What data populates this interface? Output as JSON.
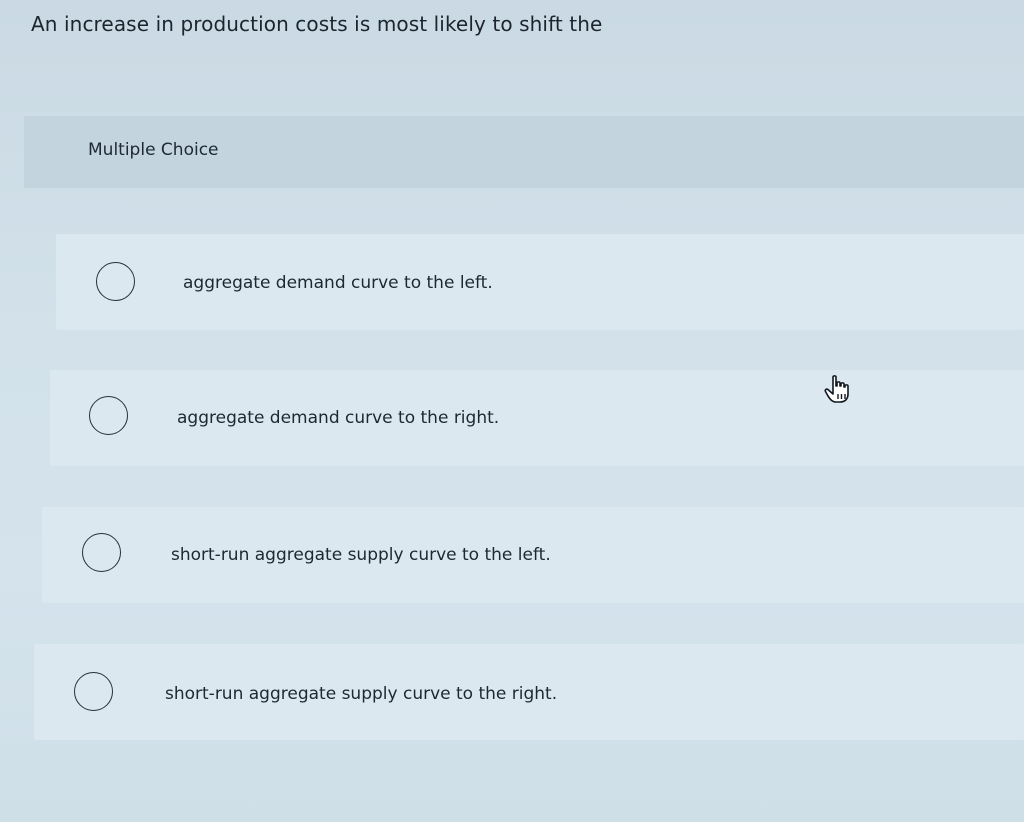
{
  "question": {
    "text": "An increase in production costs is most likely to shift the"
  },
  "section": {
    "label": "Multiple Choice"
  },
  "options": [
    {
      "label": "aggregate demand curve to the left.",
      "selected": false
    },
    {
      "label": "aggregate demand curve to the right.",
      "selected": false
    },
    {
      "label": "short-run aggregate supply curve to the left.",
      "selected": false
    },
    {
      "label": "short-run aggregate supply curve to the right.",
      "selected": false
    }
  ],
  "cursor": {
    "icon": "hand-pointer-icon"
  },
  "colors": {
    "background": "#d2e1ea",
    "header_band": "#c3d4df",
    "option_background": "#dbe8f0",
    "text": "#1d2730"
  }
}
